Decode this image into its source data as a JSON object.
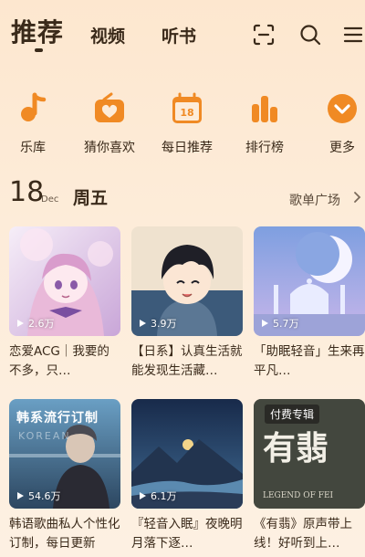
{
  "header": {
    "tabs": [
      {
        "label": "推荐",
        "active": true
      },
      {
        "label": "视频",
        "active": false
      },
      {
        "label": "听书",
        "active": false
      }
    ],
    "icons": [
      "scan-icon",
      "search-icon",
      "menu-icon"
    ]
  },
  "quick_actions": [
    {
      "label": "乐库",
      "icon": "music-note-icon"
    },
    {
      "label": "猜你喜欢",
      "icon": "radio-heart-icon"
    },
    {
      "label": "每日推荐",
      "icon": "calendar-icon",
      "badge": "18"
    },
    {
      "label": "排行榜",
      "icon": "ranking-bars-icon"
    },
    {
      "label": "更多",
      "icon": "chevron-down-icon"
    }
  ],
  "date": {
    "day": "18",
    "month": "Dec",
    "weekday": "周五"
  },
  "playlist_square": {
    "label": "歌单广场"
  },
  "playlists": [
    {
      "title": "恋爱ACG｜我要的不多，只…",
      "plays": "2.6万"
    },
    {
      "title": "【日系】认真生活就能发现生活藏…",
      "plays": "3.9万"
    },
    {
      "title": "「助眠轻音」生来再平凡…",
      "plays": "5.7万"
    },
    {
      "title": "韩语歌曲私人个性化订制，每日更新",
      "plays": "54.6万",
      "cover_text": "韩系流行订制",
      "cover_sub": "KOREAN"
    },
    {
      "title": "『轻音入眠』夜晚明月落下逐…",
      "plays": "6.1万"
    },
    {
      "title": "《有翡》原声带上线！好听到上…",
      "plays": "",
      "cover_tag": "付费专辑",
      "cover_art_text": "有翡",
      "cover_art_sub": "LEGEND OF FEI"
    }
  ],
  "colors": {
    "accent": "#f08a24",
    "background": "#fde7cf",
    "text": "#3a2a1a"
  }
}
